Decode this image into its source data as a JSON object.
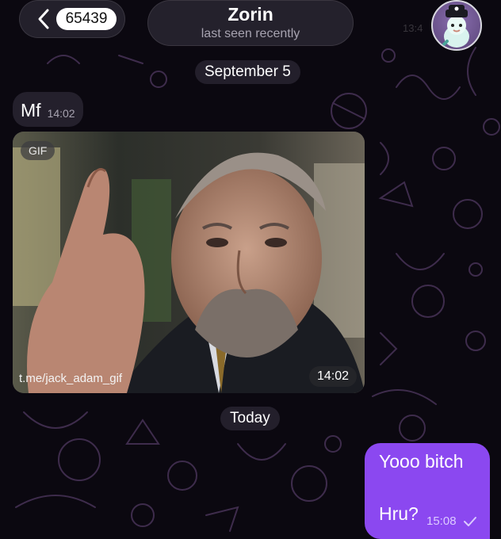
{
  "header": {
    "back_badge": "65439",
    "contact_name": "Zorin",
    "contact_status": "last seen recently",
    "ghost_time": "13:4"
  },
  "dates": {
    "first": "September 5",
    "second": "Today"
  },
  "messages": {
    "incoming_text": {
      "text": "Mf",
      "time": "14:02"
    },
    "incoming_gif": {
      "label": "GIF",
      "link": "t.me/jack_adam_gif",
      "time": "14:02"
    },
    "outgoing": {
      "line1": "Yooo bitch",
      "line2": "Hru?",
      "time": "15:08",
      "status_icon": "check-icon"
    }
  },
  "colors": {
    "outgoing_bubble": "#8b48f0",
    "incoming_bubble": "#26222e",
    "background": "#0b0810"
  }
}
